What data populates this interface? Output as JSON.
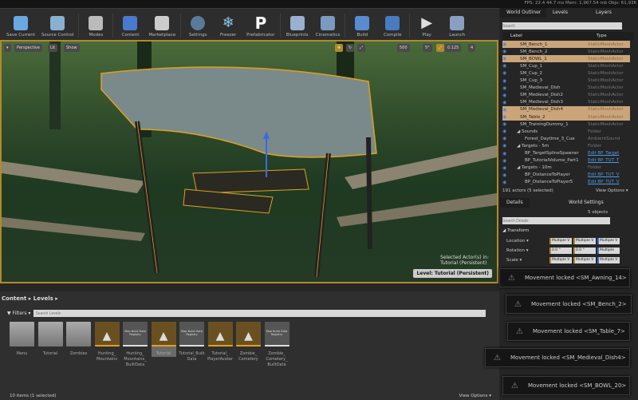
{
  "stats": {
    "fps": "FPS: 22.4",
    "ms": "44.7 ms",
    "mem": "Mem: 1,967.54 mb",
    "objs": "Objs: 61,936"
  },
  "toolbar": [
    "Save Current",
    "Source Control",
    "Modes",
    "Content",
    "Marketplace",
    "Settings",
    "Freezer",
    "Prefabricator",
    "Blueprints",
    "Cinematics",
    "Build",
    "Compile",
    "Play",
    "Launch"
  ],
  "viewport": {
    "perspective": "Perspective",
    "lit": "Lit",
    "show": "Show",
    "grid": "500",
    "angle": "5°",
    "scale": "0.125",
    "speed": "4",
    "sel1": "Selected Actor(s) in:",
    "sel2": "Tutorial (Persistent)",
    "level": "Level:  Tutorial (Persistent)"
  },
  "content": {
    "crumb": "Content ▸ Levels ▸",
    "filters": "▼ Filters ▾",
    "search_placeholder": "Search Levels",
    "footer": "10 items (1 selected)",
    "view_options": "View Options ▾",
    "items": [
      {
        "label": "Menu",
        "kind": "folder"
      },
      {
        "label": "Tutorial",
        "kind": "folder"
      },
      {
        "label": "Zombies",
        "kind": "folder"
      },
      {
        "label": "Hunting_ Mountains",
        "kind": "map"
      },
      {
        "label": "Hunting_ Mountains_ BuiltData",
        "kind": "data",
        "thumb": "Map Build Data Registry"
      },
      {
        "label": "Tutorial",
        "kind": "map",
        "selected": true
      },
      {
        "label": "Tutorial_Built Data",
        "kind": "data",
        "thumb": "Map Build Data Registry"
      },
      {
        "label": "Tutorial_ PlayerAvatar",
        "kind": "map"
      },
      {
        "label": "Zombie_ Cemetery",
        "kind": "map"
      },
      {
        "label": "Zombie_ Cemetery_ BuiltData",
        "kind": "data",
        "thumb": "Map Build Data Registry"
      }
    ]
  },
  "outliner": {
    "tabs": [
      "World Outliner",
      "Levels",
      "Layers"
    ],
    "search_placeholder": "Search",
    "col_label": "Label",
    "col_type": "Type",
    "footer": "191 actors (5 selected)",
    "view_options": "View Options ▾",
    "rows": [
      {
        "n": "SM_Bench_1",
        "t": "StaticMeshActor",
        "s": true
      },
      {
        "n": "SM_Bench_2",
        "t": "StaticMeshActor"
      },
      {
        "n": "SM_BOWL_1",
        "t": "StaticMeshActor",
        "s": true
      },
      {
        "n": "SM_Cup_1",
        "t": "StaticMeshActor"
      },
      {
        "n": "SM_Cup_2",
        "t": "StaticMeshActor"
      },
      {
        "n": "SM_Cup_3",
        "t": "StaticMeshActor"
      },
      {
        "n": "SM_Medieval_Dish",
        "t": "StaticMeshActor"
      },
      {
        "n": "SM_Medieval_Dish2",
        "t": "StaticMeshActor"
      },
      {
        "n": "SM_Medieval_Dish3",
        "t": "StaticMeshActor"
      },
      {
        "n": "SM_Medieval_Dish4",
        "t": "StaticMeshActor",
        "s": true
      },
      {
        "n": "SM_Table_2",
        "t": "StaticMeshActor",
        "s": true
      },
      {
        "n": "SM_TrainingDummy_1",
        "t": "StaticMeshActor"
      },
      {
        "n": "◢ Sounds",
        "t": "Folder",
        "f": true
      },
      {
        "n": "Forest_Daytime_3_Cue",
        "t": "AmbientSound"
      },
      {
        "n": "◢ Targets - 5m",
        "t": "Folder",
        "f": true
      },
      {
        "n": "BP_TargetSplineSpawner",
        "t": "Edit BP_Target",
        "l": true
      },
      {
        "n": "BP_TutorialVolume_Part1",
        "t": "Edit BP_TUT_T",
        "l": true
      },
      {
        "n": "◢ Targets - 10m",
        "t": "Folder",
        "f": true
      },
      {
        "n": "BP_DistanceToPlayer",
        "t": "Edit BP_TUT_V",
        "l": true
      },
      {
        "n": "BP_DistanceToPlayer5",
        "t": "Edit BP_TUT_V",
        "l": true
      }
    ]
  },
  "details": {
    "tabs": [
      "Details",
      "World Settings"
    ],
    "objects": "5 objects",
    "search_placeholder": "Search Details",
    "section": "◢ Transform",
    "location": "Location ▾",
    "rotation": "Rotation ▾",
    "scale": "Scale ▾",
    "multiple": "Multiple V",
    "rot0": "0.0 °",
    "multiple_short": "Multiple"
  },
  "toasts": [
    "Movement locked <SM_Awning_14>",
    "Movement locked <SM_Bench_2>",
    "Movement locked <SM_Table_7>",
    "Movement locked <SM_Medieval_Dish4>",
    "Movement locked <SM_BOWL_20>"
  ]
}
